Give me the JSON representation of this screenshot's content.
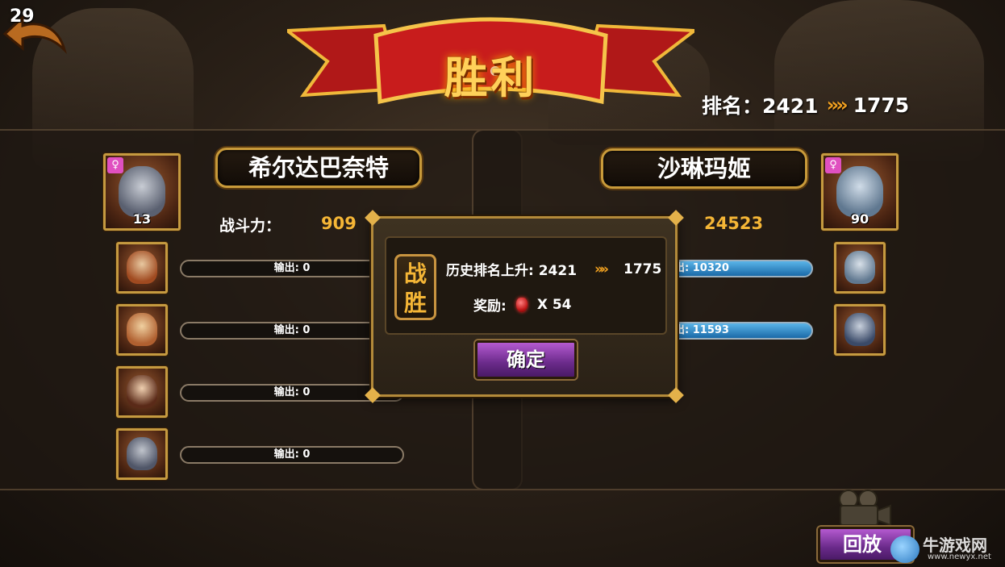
{
  "top_left": {
    "counter": "29"
  },
  "banner": {
    "title": "胜利"
  },
  "rank": {
    "label": "排名：2421",
    "arrow": "»»",
    "new_value": "1775"
  },
  "left_player": {
    "name": "希尔达巴奈特",
    "power_label": "战斗力：",
    "power": "909",
    "leader_level": "13",
    "heroes": [
      {
        "output": "输出: 0"
      },
      {
        "output": "输出: 0"
      },
      {
        "output": "输出: 0"
      },
      {
        "output": "输出: 0"
      }
    ]
  },
  "right_player": {
    "name": "沙琳玛姬",
    "power": "24523",
    "leader_level": "90",
    "heroes": [
      {
        "output": "出: 10320"
      },
      {
        "output": "出: 11593"
      }
    ]
  },
  "result_dialog": {
    "badge": "战胜",
    "history_label": "历史排名上升: 2421",
    "arrow": "»»",
    "history_new": "1775",
    "reward_label": "奖励:",
    "reward_amount": "X 54",
    "confirm_label": "确定"
  },
  "replay": {
    "label": "回放"
  },
  "watermark": {
    "text": "牛游戏网",
    "url": "www.newyx.net"
  },
  "colors": {
    "gold": "#f5b636",
    "accent_purple": "#8a3aaa",
    "bar_blue": "#2a88c8"
  },
  "icons": {
    "back": "back-arrow-icon",
    "gem": "ruby-gem-icon",
    "gender": "female-icon",
    "camera": "camera-icon"
  }
}
